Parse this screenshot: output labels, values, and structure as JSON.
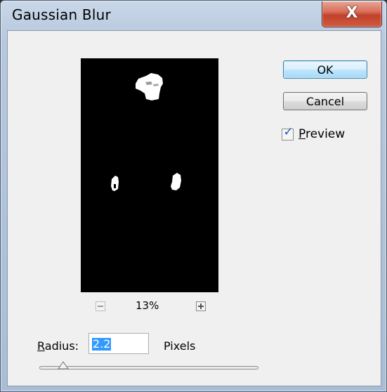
{
  "window": {
    "title": "Gaussian Blur",
    "close_label": "X"
  },
  "buttons": {
    "ok_label": "OK",
    "cancel_label": "Cancel"
  },
  "preview": {
    "checkbox_checked": true,
    "label_mnemonic": "P",
    "label_rest": "review",
    "zoom_label": "13%"
  },
  "radius": {
    "label_mnemonic": "R",
    "label_rest": "adius:",
    "value": "2.2",
    "units": "Pixels",
    "slider_fraction": 0.11
  },
  "icons": {
    "close": "close-icon",
    "zoom_out": "minus-icon",
    "zoom_in": "plus-icon",
    "check": "checkmark-icon"
  },
  "colors": {
    "selection": "#3399ff",
    "close_button": "#c2412c",
    "default_button_border": "#3c7fb1"
  }
}
